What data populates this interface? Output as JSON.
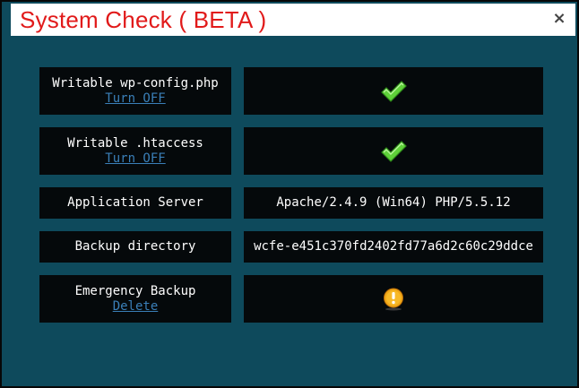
{
  "dialog": {
    "title": "System Check ( BETA )",
    "close_glyph": "×"
  },
  "rows": [
    {
      "label": "Writable wp-config.php",
      "action": "Turn OFF",
      "value_icon": "check-icon"
    },
    {
      "label": "Writable .htaccess",
      "action": "Turn OFF",
      "value_icon": "check-icon"
    },
    {
      "label": "Application Server",
      "value": "Apache/2.4.9 (Win64) PHP/5.5.12"
    },
    {
      "label": "Backup directory",
      "value": "wcfe-e451c370fd2402fd77a6d2c60c29ddce"
    },
    {
      "label": "Emergency Backup",
      "action": "Delete",
      "value_icon": "warning-icon"
    }
  ],
  "colors": {
    "title": "#e11a1a",
    "panel": "#0e4a5c",
    "cell": "#05090b",
    "link": "#3a7fb8",
    "check": "#5fd13a",
    "warning": "#f0a818"
  }
}
